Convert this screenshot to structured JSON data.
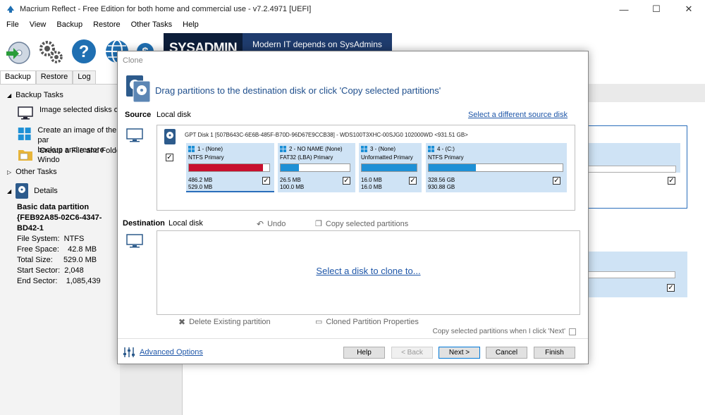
{
  "window": {
    "title": "Macrium Reflect - Free Edition for both home and commercial use - v7.2.4971  [UEFI]",
    "minimize": "—",
    "maximize": "☐",
    "close": "✕"
  },
  "menu": [
    "File",
    "View",
    "Backup",
    "Restore",
    "Other Tasks",
    "Help"
  ],
  "toolbar": {
    "banner_left": "SYSADMIN",
    "banner_right": "Modern IT depends on SysAdmins"
  },
  "left_tabs": [
    "Backup",
    "Restore",
    "Log"
  ],
  "left_pane": {
    "backup_tasks": "Backup Tasks",
    "tasks": [
      "Image selected disks on th",
      "Create an image of the par\nbackup and restore Windo",
      "Create a File and Folder ba"
    ],
    "other_tasks": "Other Tasks",
    "details": "Details",
    "details_title": "Basic data partition",
    "details_guid": "{FEB92A85-02C6-4347-BD42-1",
    "file_system": "File System:  NTFS",
    "free_space": "Free Space:    42.8 MB",
    "total_size": "Total Size:     529.0 MB",
    "start_sector": "Start Sector:  2,048",
    "end_sector": "End Sector:    1,085,439"
  },
  "dialog": {
    "title": "Clone",
    "heading": "Drag partitions to the destination disk or click 'Copy selected partitions'",
    "source_label": "Source",
    "source_disk_label": "Local disk",
    "select_different_source": "Select a different source disk",
    "disk_info": "GPT Disk 1 [507B643C-6E6B-485F-B70D-96D67E9CCB38] - WDS100T3XHC-00SJG0 102000WD  <931.51 GB>",
    "partitions": [
      {
        "name": "1 -  (None)",
        "type": "NTFS Primary",
        "used": "486.2 MB",
        "total": "529.0 MB",
        "fill": 0.92,
        "color": "#c8102e",
        "checked": true
      },
      {
        "name": "2 - NO NAME (None)",
        "type": "FAT32 (LBA) Primary",
        "used": "26.5 MB",
        "total": "100.0 MB",
        "fill": 0.27,
        "color": "#1e90d6",
        "checked": true
      },
      {
        "name": "3 -  (None)",
        "type": "Unformatted Primary",
        "used": "16.0 MB",
        "total": "16.0 MB",
        "fill": 1.0,
        "color": "#1e90d6",
        "checked": true
      },
      {
        "name": "4 -  (C:)",
        "type": "NTFS Primary",
        "used": "328.56 GB",
        "total": "930.88 GB",
        "fill": 0.35,
        "color": "#1e90d6",
        "checked": true
      }
    ],
    "destination_label": "Destination",
    "dest_disk_label": "Local disk",
    "undo": "Undo",
    "copy_selected": "Copy selected partitions",
    "select_disk_link": "Select a disk to clone to...",
    "delete_existing": "Delete Existing partition",
    "cloned_props": "Cloned Partition Properties",
    "copy_on_next": "Copy selected partitions when I click 'Next'",
    "advanced_options": "Advanced Options",
    "buttons": {
      "help": "Help",
      "back": "< Back",
      "next": "Next >",
      "cancel": "Cancel",
      "finish": "Finish"
    }
  },
  "colors": {
    "accent": "#1e56a8",
    "partition_bg": "#cfe3f5",
    "used_red": "#c8102e",
    "used_blue": "#1e90d6"
  }
}
